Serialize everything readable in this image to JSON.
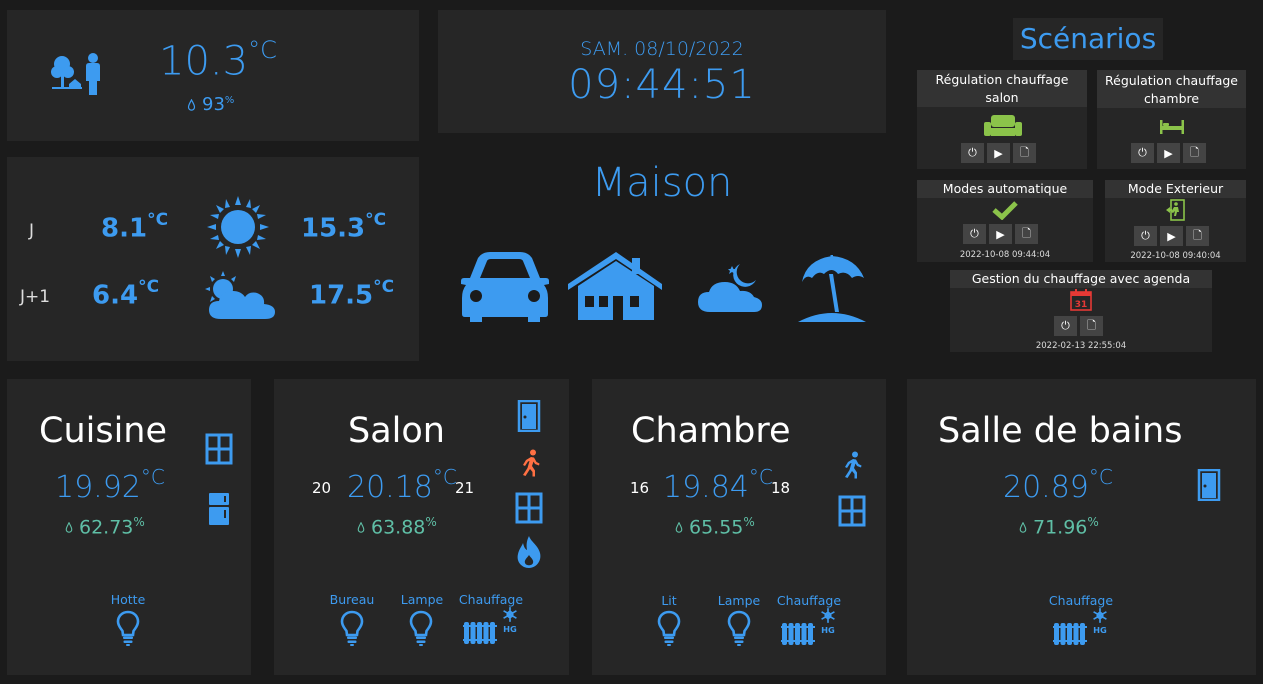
{
  "weather_now": {
    "temperature": "10.3",
    "unit": "°C",
    "humidity": "93",
    "humidity_unit": "%"
  },
  "clock": {
    "date": "SAM. 08/10/2022",
    "time": "09:44:51"
  },
  "forecast": {
    "rows": [
      {
        "label": "J",
        "min": "8.1",
        "max": "15.3",
        "icon": "sun-icon"
      },
      {
        "label": "J+1",
        "min": "6.4",
        "max": "17.5",
        "icon": "sun-cloud-icon"
      }
    ],
    "unit": "°C"
  },
  "maison": {
    "title": "Maison"
  },
  "scenarios": {
    "title": "Scénarios",
    "items": [
      {
        "name": "Régulation chauffage salon",
        "icon": "sofa-icon",
        "date": ""
      },
      {
        "name": "Régulation chauffage chambre",
        "icon": "bed-icon",
        "date": ""
      },
      {
        "name": "Modes automatique",
        "icon": "check-icon",
        "date": "2022-10-08 09:44:04"
      },
      {
        "name": "Mode Exterieur",
        "icon": "exit-door-icon",
        "date": "2022-10-08 09:40:04"
      },
      {
        "name": "Gestion du chauffage avec agenda",
        "icon": "calendar-icon",
        "date": "2022-02-13 22:55:04",
        "calendar_day": "31"
      }
    ]
  },
  "rooms": [
    {
      "name": "Cuisine",
      "temperature": "19.92",
      "humidity": "62.73",
      "devices": [
        {
          "label": "Hotte"
        }
      ]
    },
    {
      "name": "Salon",
      "temperature": "20.18",
      "humidity": "63.88",
      "setpoint_low": "20",
      "setpoint_high": "21",
      "devices": [
        {
          "label": "Bureau"
        },
        {
          "label": "Lampe"
        },
        {
          "label": "Chauffage"
        }
      ]
    },
    {
      "name": "Chambre",
      "temperature": "19.84",
      "humidity": "65.55",
      "setpoint_low": "16",
      "setpoint_high": "18",
      "devices": [
        {
          "label": "Lit"
        },
        {
          "label": "Lampe"
        },
        {
          "label": "Chauffage"
        }
      ]
    },
    {
      "name": "Salle de bains",
      "temperature": "20.89",
      "humidity": "71.96",
      "devices": [
        {
          "label": "Chauffage"
        }
      ]
    }
  ],
  "units": {
    "temp": "°C",
    "hum": "%"
  },
  "radiator_badge": "HG",
  "colors": {
    "accent": "#3d9bf0",
    "humidity": "#5fbfa6",
    "scenario_icon": "#8bc34a",
    "alert": "#ff7043",
    "calendar": "#e53935"
  }
}
